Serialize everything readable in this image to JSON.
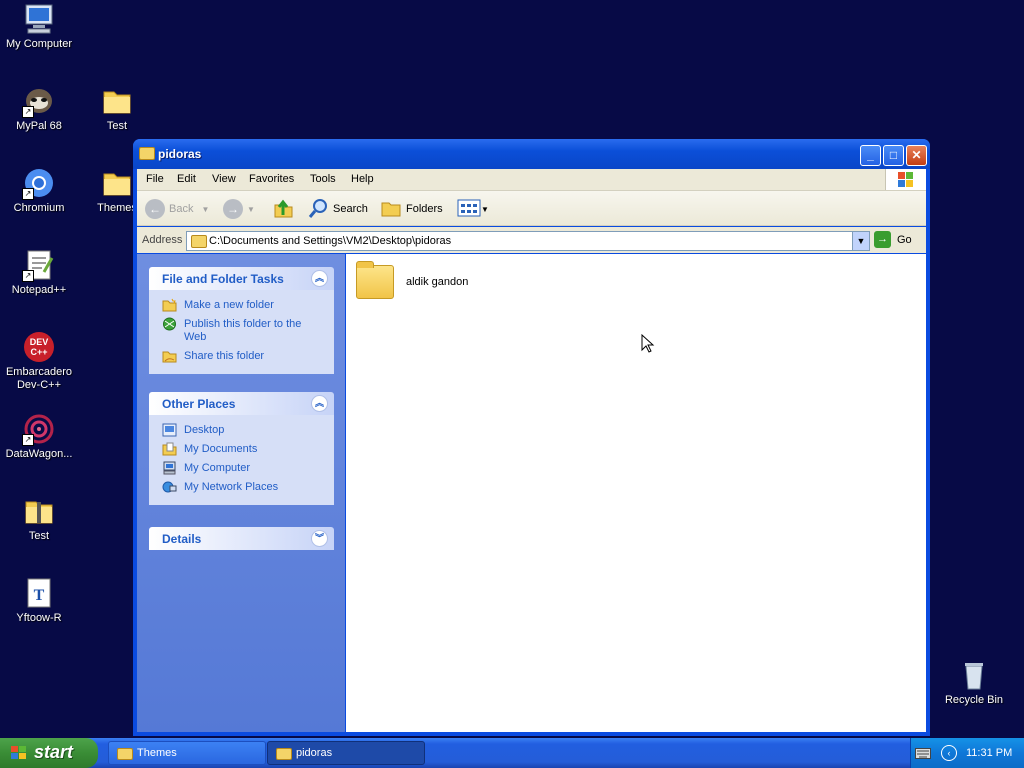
{
  "desktop": {
    "icons": [
      {
        "label": "My Computer"
      },
      {
        "label": "MyPal 68"
      },
      {
        "label": "Test"
      },
      {
        "label": "Chromium"
      },
      {
        "label": "Themes"
      },
      {
        "label": "Notepad++"
      },
      {
        "label": "Embarcadero Dev-C++"
      },
      {
        "label": "DataWagon..."
      },
      {
        "label": "Test"
      },
      {
        "label": "Yftoow-R"
      },
      {
        "label": "Recycle Bin"
      }
    ]
  },
  "window": {
    "title": "pidoras",
    "menu": [
      "File",
      "Edit",
      "View",
      "Favorites",
      "Tools",
      "Help"
    ],
    "toolbar": {
      "back": "Back",
      "search": "Search",
      "folders": "Folders"
    },
    "address": {
      "label": "Address",
      "value": "C:\\Documents and Settings\\VM2\\Desktop\\pidoras",
      "go": "Go"
    },
    "panels": {
      "tasks": {
        "title": "File and Folder Tasks",
        "items": [
          "Make a new folder",
          "Publish this folder to the Web",
          "Share this folder"
        ]
      },
      "places": {
        "title": "Other Places",
        "items": [
          "Desktop",
          "My Documents",
          "My Computer",
          "My Network Places"
        ]
      },
      "details": {
        "title": "Details"
      }
    },
    "files": [
      {
        "name": "aldik gandon"
      }
    ]
  },
  "taskbar": {
    "start": "start",
    "tasks": [
      "Themes",
      "pidoras"
    ],
    "clock": "11:31 PM"
  }
}
